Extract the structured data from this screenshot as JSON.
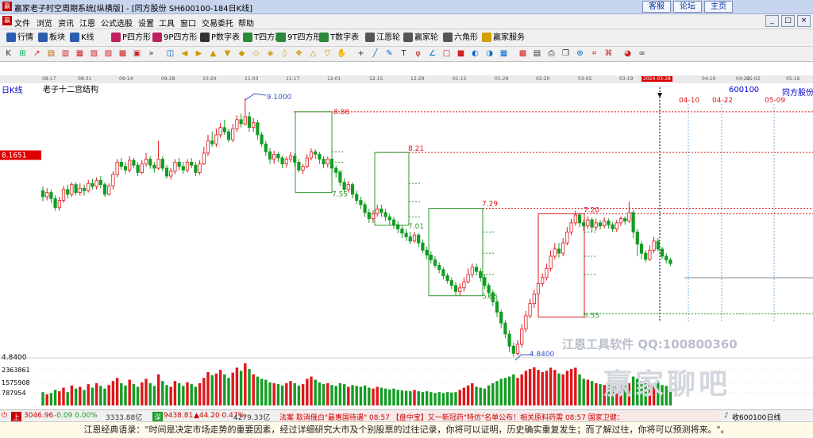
{
  "window": {
    "title": "赢家老子时空周期系统[纵横版] - [同方股份  SH600100-184日K线]",
    "buttons": [
      "客服",
      "论坛",
      "主页"
    ],
    "controls": [
      "_",
      "□",
      "×"
    ]
  },
  "menubar": [
    "文件",
    "浏览",
    "资讯",
    "江恩",
    "公式选股",
    "设置",
    "工具",
    "窗口",
    "交易委托",
    "帮助"
  ],
  "toolbar1": [
    {
      "label": "行情",
      "color": "#2a5db0"
    },
    {
      "label": "板块",
      "color": "#2a5db0"
    },
    {
      "label": "K线",
      "color": "#2a5db0"
    },
    {
      "label": "P四方形",
      "color": "#c02060"
    },
    {
      "label": "9P四方形",
      "color": "#c02060"
    },
    {
      "label": "P数字表",
      "color": "#333333"
    },
    {
      "label": "T四方形",
      "color": "#2a8a3a"
    },
    {
      "label": "9T四方形",
      "color": "#2a8a3a"
    },
    {
      "label": "T数字表",
      "color": "#2a8a3a"
    },
    {
      "label": "江恩轮",
      "color": "#555555"
    },
    {
      "label": "赢家轮",
      "color": "#555555"
    },
    {
      "label": "六角形",
      "color": "#555555"
    },
    {
      "label": "赢家服务",
      "color": "#d4a000"
    }
  ],
  "toolbar2_icons": [
    "K-icon",
    "calc-icon",
    "trend-icon",
    "bars-icon",
    "bars2-icon",
    "bars3-icon",
    "bars4-icon",
    "bars5-icon",
    "bars6-icon",
    "bars7-icon",
    "chevron-icon",
    "chart-icon",
    "arrow-left-icon",
    "arrow-right-icon",
    "arrow-up-icon",
    "arrow-down-icon",
    "diamond-icon",
    "diamond2-icon",
    "diamond3-icon",
    "diamond4-icon",
    "diamond5-icon",
    "triangle-icon",
    "triangle2-icon",
    "hand-icon",
    "cross-icon",
    "line-icon",
    "pencil-icon",
    "text-icon",
    "fib-icon",
    "gann-icon",
    "box-icon",
    "box2-icon",
    "cycle-icon",
    "cycle2-icon",
    "grid-icon",
    "grid2-icon",
    "save-icon",
    "print-icon",
    "copy-icon",
    "zoom-icon",
    "ratio-icon",
    "ratio2-icon",
    "pie-icon",
    "infinity-icon"
  ],
  "date_strip": [
    "08-17",
    "08-31",
    "09-14",
    "09-28",
    "10-20",
    "11-03",
    "11-17",
    "12-01",
    "12-15",
    "12-29",
    "01-15",
    "01-29",
    "02-20",
    "03-05",
    "03-19",
    "2024-03-28",
    "04-10",
    "04-22",
    "05-02",
    "05-16"
  ],
  "chart_header": {
    "period": "日K线",
    "indicator": "老子十二宫结构",
    "code": "600100",
    "name": "同方股份"
  },
  "colors": {
    "up": "#e0161b",
    "down": "#139c22",
    "green_box": "#2e9a2e",
    "red_box": "#e0161b",
    "cursor": "#000000",
    "gridline": "#e0161b"
  },
  "chart_data": {
    "type": "candlestick",
    "price_axis": {
      "ylim": [
        4.5,
        9.6
      ],
      "ticks": [],
      "highlight_label": "8.1651",
      "low_label": "4.8400"
    },
    "volume_axis": {
      "ticks": [
        "2363861",
        "1575908",
        "787954"
      ]
    },
    "annotations": {
      "high_label": "9.1000",
      "low_label": "4.8400",
      "levels": [
        {
          "value": 8.88,
          "color": "#e0161b"
        },
        {
          "value": 8.21,
          "color": "#e0161b"
        },
        {
          "value": 7.29,
          "color": "#e0161b"
        },
        {
          "value": 7.2,
          "color": "#e0161b"
        },
        {
          "value": 7.55,
          "color": "#2e9a2e"
        },
        {
          "value": 7.01,
          "color": "#2e9a2e"
        },
        {
          "value": 5.85,
          "color": "#2e9a2e"
        },
        {
          "value": 5.55,
          "color": "#2e9a2e"
        }
      ],
      "future_dates": [
        "04-10",
        "04-22",
        "05-09"
      ],
      "cursor_date": "2024-03-28"
    },
    "candles": [
      [
        7.58,
        7.48,
        7.65,
        7.4
      ],
      [
        7.48,
        7.55,
        7.62,
        7.42
      ],
      [
        7.55,
        7.45,
        7.6,
        7.38
      ],
      [
        7.45,
        7.3,
        7.5,
        7.25
      ],
      [
        7.3,
        7.42,
        7.48,
        7.25
      ],
      [
        7.42,
        7.6,
        7.66,
        7.38
      ],
      [
        7.6,
        7.52,
        7.68,
        7.45
      ],
      [
        7.52,
        7.68,
        7.72,
        7.48
      ],
      [
        7.68,
        7.55,
        7.72,
        7.5
      ],
      [
        7.55,
        7.62,
        7.7,
        7.5
      ],
      [
        7.62,
        7.58,
        7.68,
        7.5
      ],
      [
        7.58,
        7.7,
        7.76,
        7.55
      ],
      [
        7.7,
        7.65,
        7.78,
        7.6
      ],
      [
        7.65,
        7.75,
        7.8,
        7.6
      ],
      [
        7.75,
        7.68,
        7.82,
        7.62
      ],
      [
        7.68,
        7.52,
        7.72,
        7.48
      ],
      [
        7.52,
        7.66,
        7.7,
        7.5
      ],
      [
        7.66,
        7.85,
        7.9,
        7.6
      ],
      [
        7.85,
        8.05,
        8.1,
        7.8
      ],
      [
        8.05,
        7.98,
        8.12,
        7.92
      ],
      [
        7.98,
        7.92,
        8.05,
        7.85
      ],
      [
        7.92,
        8.08,
        8.15,
        7.88
      ],
      [
        8.08,
        8.0,
        8.12,
        7.95
      ],
      [
        8.0,
        7.88,
        8.05,
        7.82
      ],
      [
        7.88,
        8.02,
        8.08,
        7.85
      ],
      [
        8.02,
        8.1,
        8.2,
        7.98
      ],
      [
        8.1,
        8.0,
        8.15,
        7.94
      ],
      [
        8.0,
        7.95,
        8.05,
        7.88
      ],
      [
        7.95,
        8.1,
        8.4,
        7.92
      ],
      [
        8.1,
        7.95,
        8.15,
        7.9
      ],
      [
        7.95,
        7.82,
        8.0,
        7.78
      ],
      [
        7.82,
        7.9,
        7.95,
        7.76
      ],
      [
        7.9,
        8.05,
        8.1,
        7.85
      ],
      [
        8.05,
        7.98,
        8.12,
        7.92
      ],
      [
        7.98,
        7.92,
        8.05,
        7.86
      ],
      [
        7.92,
        8.05,
        8.1,
        7.88
      ],
      [
        8.05,
        8.0,
        8.12,
        7.95
      ],
      [
        8.0,
        7.88,
        8.05,
        7.82
      ],
      [
        7.88,
        8.02,
        8.08,
        7.84
      ],
      [
        8.02,
        8.2,
        8.3,
        8.0
      ],
      [
        8.2,
        8.4,
        8.5,
        8.15
      ],
      [
        8.4,
        8.35,
        8.55,
        8.3
      ],
      [
        8.35,
        8.5,
        8.6,
        8.3
      ],
      [
        8.5,
        8.62,
        8.7,
        8.45
      ],
      [
        8.62,
        8.55,
        8.75,
        8.5
      ],
      [
        8.55,
        8.42,
        8.6,
        8.38
      ],
      [
        8.42,
        8.6,
        8.68,
        8.38
      ],
      [
        8.6,
        8.75,
        8.82,
        8.55
      ],
      [
        8.75,
        8.68,
        8.85,
        8.62
      ],
      [
        8.68,
        8.8,
        9.1,
        8.65
      ],
      [
        8.8,
        8.62,
        8.88,
        8.55
      ],
      [
        8.62,
        8.7,
        8.78,
        8.55
      ],
      [
        8.7,
        8.5,
        8.75,
        8.42
      ],
      [
        8.5,
        8.35,
        8.55,
        8.3
      ],
      [
        8.35,
        8.22,
        8.4,
        8.15
      ],
      [
        8.22,
        8.1,
        8.28,
        8.02
      ],
      [
        8.1,
        8.18,
        8.24,
        8.02
      ],
      [
        8.18,
        8.12,
        8.22,
        8.05
      ],
      [
        8.12,
        8.02,
        8.16,
        7.95
      ],
      [
        8.02,
        8.1,
        8.14,
        7.96
      ],
      [
        8.1,
        8.15,
        8.22,
        8.05
      ],
      [
        8.15,
        8.05,
        8.2,
        7.98
      ],
      [
        8.05,
        7.92,
        8.1,
        7.88
      ],
      [
        7.92,
        7.98,
        8.02,
        7.85
      ],
      [
        7.98,
        8.12,
        8.18,
        7.95
      ],
      [
        8.12,
        8.22,
        8.28,
        8.08
      ],
      [
        8.22,
        8.18,
        8.26,
        8.1
      ],
      [
        8.18,
        8.1,
        8.22,
        8.02
      ],
      [
        8.1,
        8.02,
        8.15,
        7.95
      ],
      [
        8.02,
        8.1,
        8.14,
        7.96
      ],
      [
        8.1,
        7.95,
        8.12,
        7.9
      ],
      [
        7.95,
        7.88,
        8.0,
        7.8
      ],
      [
        7.88,
        7.72,
        7.92,
        7.66
      ],
      [
        7.72,
        7.6,
        7.78,
        7.55
      ],
      [
        7.6,
        7.68,
        7.74,
        7.55
      ],
      [
        7.68,
        7.52,
        7.72,
        7.45
      ],
      [
        7.52,
        7.42,
        7.58,
        7.36
      ],
      [
        7.42,
        7.35,
        7.48,
        7.28
      ],
      [
        7.35,
        7.22,
        7.4,
        7.15
      ],
      [
        7.22,
        7.12,
        7.28,
        7.05
      ],
      [
        7.12,
        7.2,
        7.26,
        7.05
      ],
      [
        7.2,
        7.28,
        7.35,
        7.15
      ],
      [
        7.28,
        7.22,
        7.35,
        7.15
      ],
      [
        7.22,
        7.15,
        7.28,
        7.08
      ],
      [
        7.15,
        7.1,
        7.2,
        7.02
      ],
      [
        7.1,
        7.02,
        7.15,
        6.95
      ],
      [
        7.02,
        6.95,
        7.08,
        6.88
      ],
      [
        6.95,
        6.88,
        7.0,
        6.8
      ],
      [
        6.88,
        6.82,
        6.95,
        6.75
      ],
      [
        6.82,
        6.75,
        6.9,
        6.7
      ],
      [
        6.75,
        6.85,
        6.9,
        6.72
      ],
      [
        6.85,
        6.72,
        6.88,
        6.65
      ],
      [
        6.72,
        6.6,
        6.78,
        6.55
      ],
      [
        6.6,
        6.52,
        6.66,
        6.45
      ],
      [
        6.52,
        6.44,
        6.58,
        6.38
      ],
      [
        6.44,
        6.35,
        6.5,
        6.3
      ],
      [
        6.35,
        6.28,
        6.4,
        6.22
      ],
      [
        6.28,
        6.18,
        6.32,
        6.12
      ],
      [
        6.18,
        6.1,
        6.22,
        6.05
      ],
      [
        6.1,
        6.02,
        6.15,
        5.96
      ],
      [
        6.02,
        5.92,
        6.08,
        5.85
      ],
      [
        5.92,
        5.98,
        6.05,
        5.85
      ],
      [
        5.98,
        6.08,
        6.15,
        5.92
      ],
      [
        6.08,
        6.2,
        6.3,
        6.05
      ],
      [
        6.2,
        6.32,
        6.38,
        6.15
      ],
      [
        6.32,
        6.25,
        6.38,
        6.18
      ],
      [
        6.25,
        6.15,
        6.3,
        6.08
      ],
      [
        6.15,
        6.02,
        6.2,
        5.96
      ],
      [
        6.02,
        5.9,
        6.06,
        5.82
      ],
      [
        5.9,
        5.75,
        5.95,
        5.68
      ],
      [
        5.75,
        5.58,
        5.8,
        5.5
      ],
      [
        5.58,
        5.4,
        5.62,
        5.32
      ],
      [
        5.4,
        5.22,
        5.45,
        5.15
      ],
      [
        5.22,
        5.02,
        5.28,
        4.92
      ],
      [
        5.02,
        4.9,
        5.08,
        4.84
      ],
      [
        4.9,
        5.05,
        5.12,
        4.86
      ],
      [
        5.05,
        5.3,
        5.38,
        5.0
      ],
      [
        5.3,
        5.52,
        5.6,
        5.25
      ],
      [
        5.52,
        5.72,
        5.8,
        5.48
      ],
      [
        5.72,
        5.88,
        5.95,
        5.65
      ],
      [
        5.88,
        6.05,
        6.12,
        5.82
      ],
      [
        6.05,
        6.15,
        6.22,
        6.0
      ],
      [
        6.15,
        6.3,
        6.38,
        6.1
      ],
      [
        6.3,
        6.5,
        6.6,
        6.25
      ],
      [
        6.5,
        6.62,
        6.72,
        6.45
      ],
      [
        6.62,
        6.55,
        6.72,
        6.48
      ],
      [
        6.55,
        6.72,
        6.8,
        6.5
      ],
      [
        6.72,
        6.9,
        6.98,
        6.68
      ],
      [
        6.9,
        7.05,
        7.12,
        6.85
      ],
      [
        7.05,
        7.18,
        7.25,
        7.0
      ],
      [
        7.18,
        7.05,
        7.22,
        6.98
      ],
      [
        7.05,
        7.0,
        7.1,
        6.92
      ],
      [
        7.0,
        7.1,
        7.16,
        6.95
      ],
      [
        7.1,
        6.98,
        7.14,
        6.9
      ],
      [
        6.98,
        7.05,
        7.12,
        6.92
      ],
      [
        7.05,
        7.0,
        7.1,
        6.94
      ],
      [
        7.0,
        7.08,
        7.14,
        6.96
      ],
      [
        7.08,
        7.02,
        7.12,
        6.96
      ],
      [
        7.02,
        6.95,
        7.06,
        6.9
      ],
      [
        6.95,
        7.05,
        7.1,
        6.9
      ],
      [
        7.05,
        7.12,
        7.16,
        7.0
      ],
      [
        7.12,
        7.08,
        7.16,
        7.02
      ],
      [
        7.08,
        7.22,
        7.4,
        7.05
      ],
      [
        7.22,
        6.9,
        7.26,
        6.8
      ],
      [
        6.9,
        6.7,
        6.95,
        6.5
      ],
      [
        6.7,
        6.55,
        6.75,
        6.45
      ],
      [
        6.55,
        6.45,
        6.6,
        6.4
      ],
      [
        6.45,
        6.6,
        6.68,
        6.42
      ],
      [
        6.6,
        6.75,
        6.82,
        6.55
      ],
      [
        6.75,
        6.62,
        6.8,
        6.58
      ],
      [
        6.62,
        6.5,
        6.66,
        6.45
      ],
      [
        6.5,
        6.44,
        6.55,
        6.38
      ],
      [
        6.44,
        6.38,
        6.48,
        6.34
      ]
    ],
    "volume": [
      0.3,
      0.25,
      0.28,
      0.35,
      0.32,
      0.4,
      0.3,
      0.45,
      0.38,
      0.42,
      0.35,
      0.48,
      0.4,
      0.5,
      0.44,
      0.38,
      0.46,
      0.55,
      0.62,
      0.5,
      0.45,
      0.58,
      0.48,
      0.42,
      0.52,
      0.6,
      0.5,
      0.44,
      0.7,
      0.55,
      0.46,
      0.42,
      0.55,
      0.5,
      0.44,
      0.52,
      0.48,
      0.42,
      0.5,
      0.62,
      0.75,
      0.68,
      0.72,
      0.8,
      0.7,
      0.62,
      0.74,
      0.85,
      0.78,
      0.95,
      0.82,
      0.7,
      0.65,
      0.6,
      0.58,
      0.52,
      0.5,
      0.48,
      0.45,
      0.5,
      0.55,
      0.5,
      0.45,
      0.48,
      0.6,
      0.65,
      0.58,
      0.52,
      0.48,
      0.5,
      0.46,
      0.44,
      0.5,
      0.48,
      0.42,
      0.46,
      0.44,
      0.42,
      0.45,
      0.4,
      0.38,
      0.42,
      0.4,
      0.38,
      0.36,
      0.38,
      0.35,
      0.34,
      0.33,
      0.32,
      0.35,
      0.32,
      0.3,
      0.32,
      0.3,
      0.28,
      0.3,
      0.28,
      0.3,
      0.29,
      0.3,
      0.35,
      0.4,
      0.45,
      0.5,
      0.42,
      0.4,
      0.38,
      0.45,
      0.5,
      0.55,
      0.6,
      0.62,
      0.65,
      0.7,
      0.62,
      0.7,
      0.78,
      0.82,
      0.86,
      0.8,
      0.75,
      0.78,
      0.85,
      0.8,
      0.72,
      0.7,
      0.78,
      0.82,
      0.85,
      0.7,
      0.6,
      0.58,
      0.55,
      0.5,
      0.48,
      0.46,
      0.48,
      0.45,
      0.44,
      0.46,
      0.45,
      0.5,
      0.65,
      0.6,
      0.55,
      0.5,
      0.48,
      0.5,
      0.52,
      0.46,
      0.44,
      0.42
    ]
  },
  "watermark": {
    "line1": "江恩工具软件  QQ:100800360",
    "line2": "赢家聊吧"
  },
  "statusbar": {
    "sh": "3046.96",
    "sh_change": "-0.09 0.00%",
    "sh_amount": "3333.88亿",
    "sz": "9438.81",
    "sz_change": "▲44.20 0.47%",
    "sz_amount": "4279.33亿",
    "news": "法案 取消俄白\"最惠国待遇\"   08:57 【盘中宝】又一新冠药\"特仿\"名单公布！相关原料药需   08:57 国家卫健：",
    "sound_label": "收600100日线"
  },
  "quote": "江恩经典语录：\"时间是决定市场走势的重要因素，经过详细研究大市及个别股票的过往记录，你将可以证明，历史确实重复发生；而了解过往，你将可以预测将来。\"。"
}
